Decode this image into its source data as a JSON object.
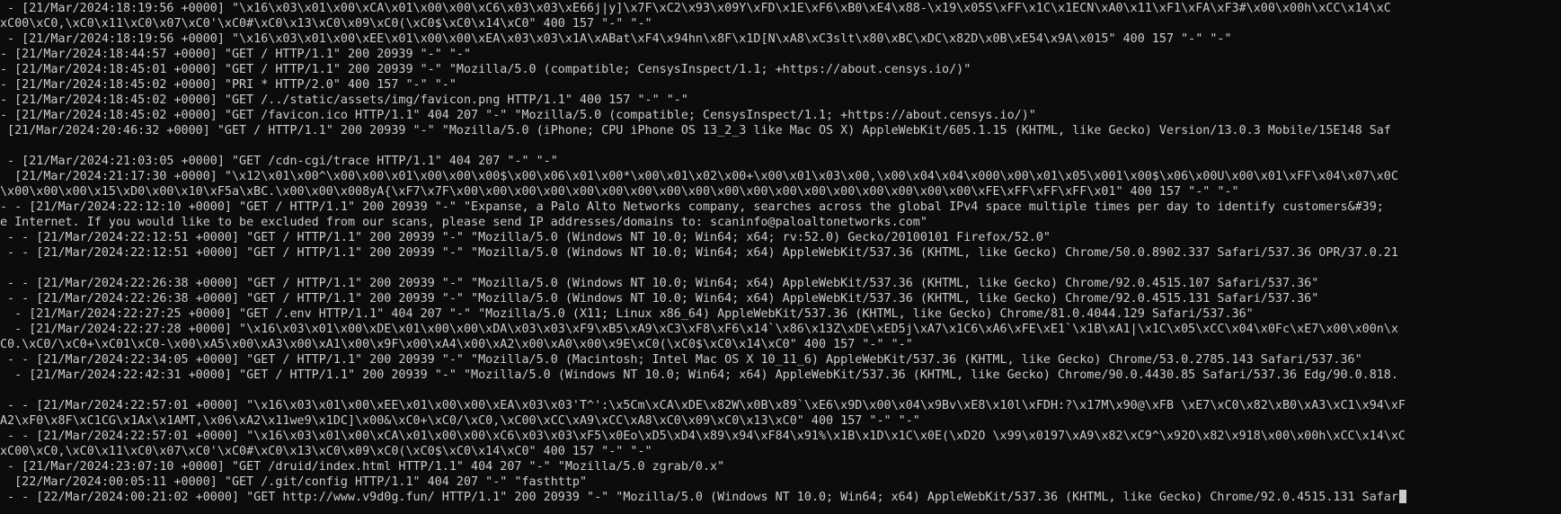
{
  "terminal": {
    "lines": [
      " - [21/Mar/2024:18:19:56 +0000] \"\\x16\\x03\\x01\\x00\\xCA\\x01\\x00\\x00\\xC6\\x03\\x03\\xE66j|y]\\x7F\\xC2\\x93\\x09Y\\xFD\\x1E\\xF6\\xB0\\xE4\\x88-\\x19\\x05S\\xFF\\x1C\\x1ECN\\xA0\\x11\\xF1\\xFA\\xF3#\\x00\\x00h\\xCC\\x14\\xC",
      "xC00\\xC0,\\xC0\\x11\\xC0\\x07\\xC0'\\xC0#\\xC0\\x13\\xC0\\x09\\xC0(\\xC0$\\xC0\\x14\\xC0\" 400 157 \"-\" \"-\"",
      " - [21/Mar/2024:18:19:56 +0000] \"\\x16\\x03\\x01\\x00\\xEE\\x01\\x00\\x00\\xEA\\x03\\x03\\x1A\\xABat\\xF4\\x94hn\\x8F\\x1D[N\\xA8\\xC3slt\\x80\\xBC\\xDC\\x82D\\x0B\\xE54\\x9A\\x015\" 400 157 \"-\" \"-\"",
      "- [21/Mar/2024:18:44:57 +0000] \"GET / HTTP/1.1\" 200 20939 \"-\" \"-\"",
      "- [21/Mar/2024:18:45:01 +0000] \"GET / HTTP/1.1\" 200 20939 \"-\" \"Mozilla/5.0 (compatible; CensysInspect/1.1; +https://about.censys.io/)\"",
      "- [21/Mar/2024:18:45:02 +0000] \"PRI * HTTP/2.0\" 400 157 \"-\" \"-\"",
      "- [21/Mar/2024:18:45:02 +0000] \"GET /../static/assets/img/favicon.png HTTP/1.1\" 400 157 \"-\" \"-\"",
      "- [21/Mar/2024:18:45:02 +0000] \"GET /favicon.ico HTTP/1.1\" 404 207 \"-\" \"Mozilla/5.0 (compatible; CensysInspect/1.1; +https://about.censys.io/)\"",
      " [21/Mar/2024:20:46:32 +0000] \"GET / HTTP/1.1\" 200 20939 \"-\" \"Mozilla/5.0 (iPhone; CPU iPhone OS 13_2_3 like Mac OS X) AppleWebKit/605.1.15 (KHTML, like Gecko) Version/13.0.3 Mobile/15E148 Saf",
      "",
      " - [21/Mar/2024:21:03:05 +0000] \"GET /cdn-cgi/trace HTTP/1.1\" 404 207 \"-\" \"-\"",
      "  [21/Mar/2024:21:17:30 +0000] \"\\x12\\x01\\x00^\\x00\\x00\\x01\\x00\\x00\\x00$\\x00\\x06\\x01\\x00*\\x00\\x01\\x02\\x00+\\x00\\x01\\x03\\x00,\\x00\\x04\\x04\\x000\\x00\\x01\\x05\\x001\\x00$\\x06\\x00U\\x00\\x01\\xFF\\x04\\x07\\x0C",
      "\\x00\\x00\\x00\\x15\\xD0\\x00\\x10\\xF5a\\xBC.\\x00\\x00\\x008yA{\\xF7\\x7F\\x00\\x00\\x00\\x00\\x00\\x00\\x00\\x00\\x00\\x00\\x00\\x00\\x00\\x00\\x00\\x00\\x00\\x00\\xFE\\xFF\\xFF\\xFF\\x01\" 400 157 \"-\" \"-\"",
      "- - [21/Mar/2024:22:12:10 +0000] \"GET / HTTP/1.1\" 200 20939 \"-\" \"Expanse, a Palo Alto Networks company, searches across the global IPv4 space multiple times per day to identify customers&#39;",
      "e Internet. If you would like to be excluded from our scans, please send IP addresses/domains to: scaninfo@paloaltonetworks.com\"",
      " - - [21/Mar/2024:22:12:51 +0000] \"GET / HTTP/1.1\" 200 20939 \"-\" \"Mozilla/5.0 (Windows NT 10.0; Win64; x64; rv:52.0) Gecko/20100101 Firefox/52.0\"",
      " - - [21/Mar/2024:22:12:51 +0000] \"GET / HTTP/1.1\" 200 20939 \"-\" \"Mozilla/5.0 (Windows NT 10.0; Win64; x64) AppleWebKit/537.36 (KHTML, like Gecko) Chrome/50.0.8902.337 Safari/537.36 OPR/37.0.21",
      "",
      " - - [21/Mar/2024:22:26:38 +0000] \"GET / HTTP/1.1\" 200 20939 \"-\" \"Mozilla/5.0 (Windows NT 10.0; Win64; x64) AppleWebKit/537.36 (KHTML, like Gecko) Chrome/92.0.4515.107 Safari/537.36\"",
      " - - [21/Mar/2024:22:26:38 +0000] \"GET / HTTP/1.1\" 200 20939 \"-\" \"Mozilla/5.0 (Windows NT 10.0; Win64; x64) AppleWebKit/537.36 (KHTML, like Gecko) Chrome/92.0.4515.131 Safari/537.36\"",
      "  - [21/Mar/2024:22:27:25 +0000] \"GET /.env HTTP/1.1\" 404 207 \"-\" \"Mozilla/5.0 (X11; Linux x86_64) AppleWebKit/537.36 (KHTML, like Gecko) Chrome/81.0.4044.129 Safari/537.36\"",
      "  - [21/Mar/2024:22:27:28 +0000] \"\\x16\\x03\\x01\\x00\\xDE\\x01\\x00\\x00\\xDA\\x03\\x03\\xF9\\xB5\\xA9\\xC3\\xF8\\xF6\\x14`\\x86\\x13Z\\xDE\\xED5j\\xA7\\x1C6\\xA6\\xFE\\xE1`\\x1B\\xA1|\\x1C\\x05\\xCC\\x04\\x0Fc\\xE7\\x00\\x00n\\x",
      "C0.\\xC0/\\xC0+\\xC01\\xC0-\\x00\\xA5\\x00\\xA3\\x00\\xA1\\x00\\x9F\\x00\\xA4\\x00\\xA2\\x00\\xA0\\x00\\x9E\\xC0(\\xC0$\\xC0\\x14\\xC0\" 400 157 \"-\" \"-\"",
      " - - [21/Mar/2024:22:34:05 +0000] \"GET / HTTP/1.1\" 200 20939 \"-\" \"Mozilla/5.0 (Macintosh; Intel Mac OS X 10_11_6) AppleWebKit/537.36 (KHTML, like Gecko) Chrome/53.0.2785.143 Safari/537.36\"",
      "  - [21/Mar/2024:22:42:31 +0000] \"GET / HTTP/1.1\" 200 20939 \"-\" \"Mozilla/5.0 (Windows NT 10.0; Win64; x64) AppleWebKit/537.36 (KHTML, like Gecko) Chrome/90.0.4430.85 Safari/537.36 Edg/90.0.818.",
      "",
      " - - [21/Mar/2024:22:57:01 +0000] \"\\x16\\x03\\x01\\x00\\xEE\\x01\\x00\\x00\\xEA\\x03\\x03'T^':\\x5Cm\\xCA\\xDE\\x82W\\x0B\\x89`\\xE6\\x9D\\x00\\x04\\x9Bv\\xE8\\x10l\\xFDH:?\\x17M\\x90@\\xFB \\xE7\\xC0\\x82\\xB0\\xA3\\xC1\\x94\\xF",
      "A2\\xF0\\x8F\\xC1CG\\x1Ax\\x1AMT,\\x06\\xA2\\x11we9\\x1DC]\\x00&\\xC0+\\xC0/\\xC0,\\xC00\\xCC\\xA9\\xCC\\xA8\\xC0\\x09\\xC0\\x13\\xC0\" 400 157 \"-\" \"-\"",
      " - - [21/Mar/2024:22:57:01 +0000] \"\\x16\\x03\\x01\\x00\\xCA\\x01\\x00\\x00\\xC6\\x03\\x03\\xF5\\x0Eo\\xD5\\xD4\\x89\\x94\\xF84\\x91%\\x1B\\x1D\\x1C\\x0E(\\xD2O \\x99\\x0197\\xA9\\x82\\xC9^\\x92O\\x82\\x918\\x00\\x00h\\xCC\\x14\\xC",
      "xC00\\xC0,\\xC0\\x11\\xC0\\x07\\xC0'\\xC0#\\xC0\\x13\\xC0\\x09\\xC0(\\xC0$\\xC0\\x14\\xC0\" 400 157 \"-\" \"-\"",
      " - [21/Mar/2024:23:07:10 +0000] \"GET /druid/index.html HTTP/1.1\" 404 207 \"-\" \"Mozilla/5.0 zgrab/0.x\"",
      "  [22/Mar/2024:00:05:11 +0000] \"GET /.git/config HTTP/1.1\" 404 207 \"-\" \"fasthttp\"",
      " - - [22/Mar/2024:00:21:02 +0000] \"GET http://www.v9d0g.fun/ HTTP/1.1\" 200 20939 \"-\" \"Mozilla/5.0 (Windows NT 10.0; Win64; x64) AppleWebKit/537.36 (KHTML, like Gecko) Chrome/92.0.4515.131 Safar"
    ]
  },
  "colors": {
    "background": "#0c0c0c",
    "text": "#cccccc"
  }
}
